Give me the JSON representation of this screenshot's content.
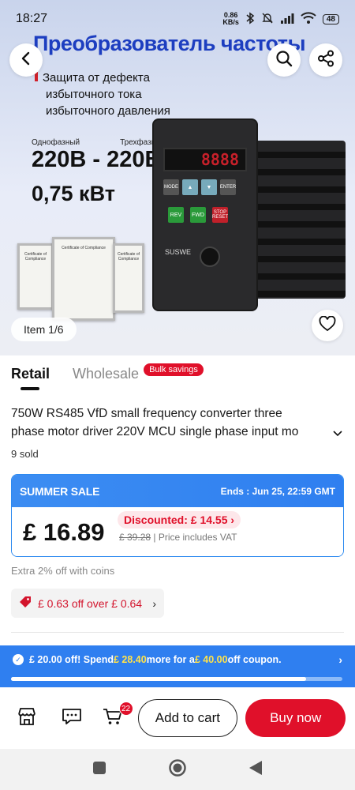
{
  "status_bar": {
    "time": "18:27",
    "speed": "0.86",
    "speed_unit": "KB/s",
    "battery": "48"
  },
  "hero": {
    "title": "Преобразователь частоты",
    "bullets": [
      "Защита от дефекта",
      "избыточного тока",
      "избыточного давления"
    ],
    "phase_single": "Однофазный",
    "phase_three": "Трехфазный",
    "voltage": "220В - 220В",
    "power": "0,75 кВт",
    "display_value": "8888",
    "device_brand": "SUSWE",
    "button_mode": "MODE",
    "button_enter": "ENTER",
    "button_rev": "REV",
    "button_fwd": "FWD",
    "button_stop": "STOP RESET",
    "cert_label": "Certificate of Compliance",
    "item_counter": "Item 1/6"
  },
  "tabs": {
    "retail": "Retail",
    "wholesale": "Wholesale",
    "bulk_badge": "Bulk savings"
  },
  "product": {
    "title_line1": "750W RS485 VfD small frequency converter three",
    "title_line2": "phase motor driver 220V MCU single phase input mo",
    "sold": "9 sold"
  },
  "price": {
    "sale_label": "SUMMER SALE",
    "ends": "Ends :  Jun 25, 22:59 GMT",
    "current": "£ 16.89",
    "discount": "Discounted: £ 14.55",
    "original": "£ 39.28",
    "vat_note": " | Price includes VAT"
  },
  "coins_text": "Extra 2% off with coins",
  "coupon_chip": "£ 0.63 off over  £ 0.64",
  "promo": {
    "part1": "£ 20.00 off! Spend ",
    "amount1": "£ 28.40",
    "part2": " more for a ",
    "amount2": "£ 40.00",
    "part3": " off coupon.",
    "progress": 0.89
  },
  "action_bar": {
    "cart_count": "22",
    "add_to_cart": "Add to cart",
    "buy_now": "Buy now"
  },
  "colors": {
    "brand_red": "#e0102a",
    "sale_blue": "#2f7ff0",
    "title_blue": "#1d3ec0"
  }
}
